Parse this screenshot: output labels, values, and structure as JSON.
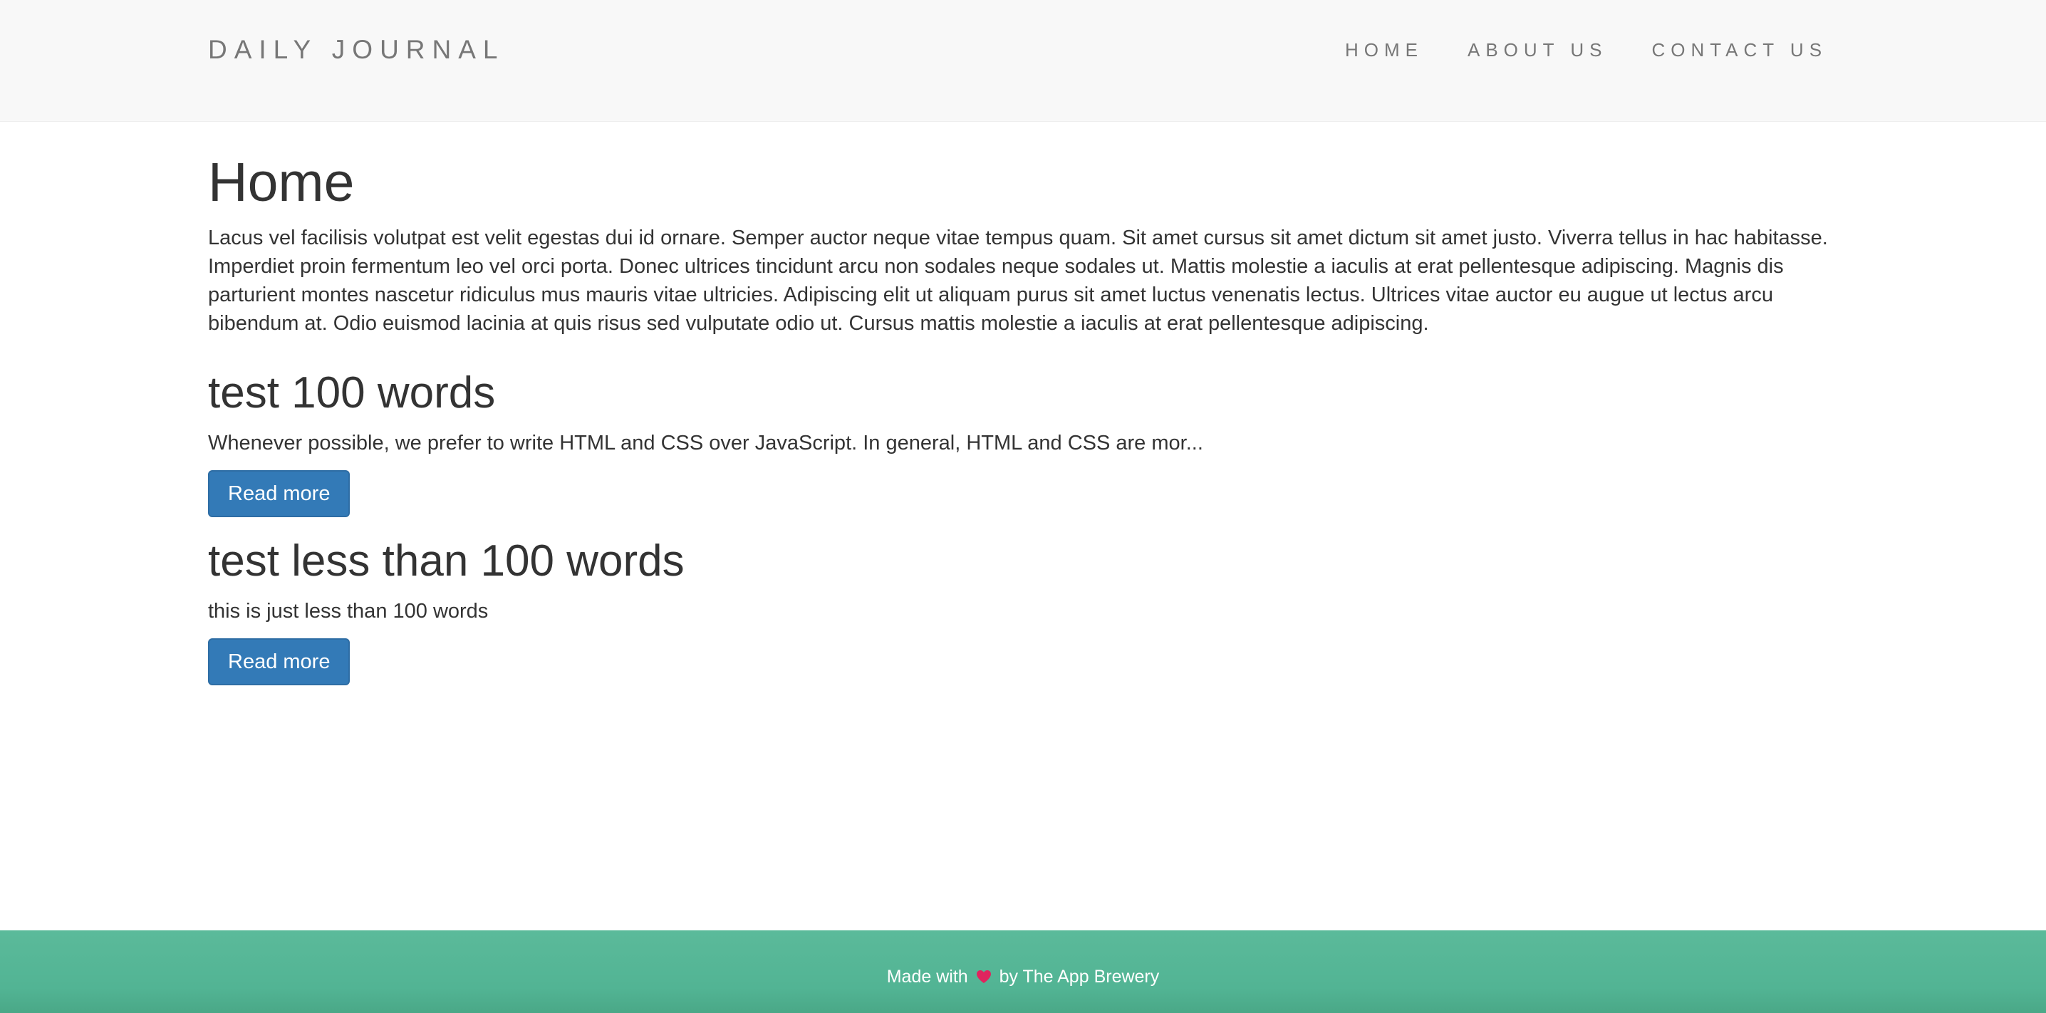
{
  "header": {
    "brand": "DAILY JOURNAL",
    "nav": [
      {
        "label": "HOME"
      },
      {
        "label": "ABOUT US"
      },
      {
        "label": "CONTACT US"
      }
    ]
  },
  "main": {
    "title": "Home",
    "intro": "Lacus vel facilisis volutpat est velit egestas dui id ornare. Semper auctor neque vitae tempus quam. Sit amet cursus sit amet dictum sit amet justo. Viverra tellus in hac habitasse. Imperdiet proin fermentum leo vel orci porta. Donec ultrices tincidunt arcu non sodales neque sodales ut. Mattis molestie a iaculis at erat pellentesque adipiscing. Magnis dis parturient montes nascetur ridiculus mus mauris vitae ultricies. Adipiscing elit ut aliquam purus sit amet luctus venenatis lectus. Ultrices vitae auctor eu augue ut lectus arcu bibendum at. Odio euismod lacinia at quis risus sed vulputate odio ut. Cursus mattis molestie a iaculis at erat pellentesque adipiscing.",
    "posts": [
      {
        "title": "test 100 words",
        "excerpt": "Whenever possible, we prefer to write HTML and CSS over JavaScript. In general, HTML and CSS are mor...",
        "button": "Read more"
      },
      {
        "title": "test less than 100 words",
        "excerpt": "this is just less than 100 words",
        "button": "Read more"
      }
    ]
  },
  "footer": {
    "prefix": "Made with",
    "icon": "heart-icon",
    "suffix": "by The App Brewery"
  },
  "colors": {
    "navbar_bg": "#f8f8f8",
    "button_bg": "#337ab7",
    "footer_bg": "#52b494",
    "heart": "#e0245e"
  }
}
